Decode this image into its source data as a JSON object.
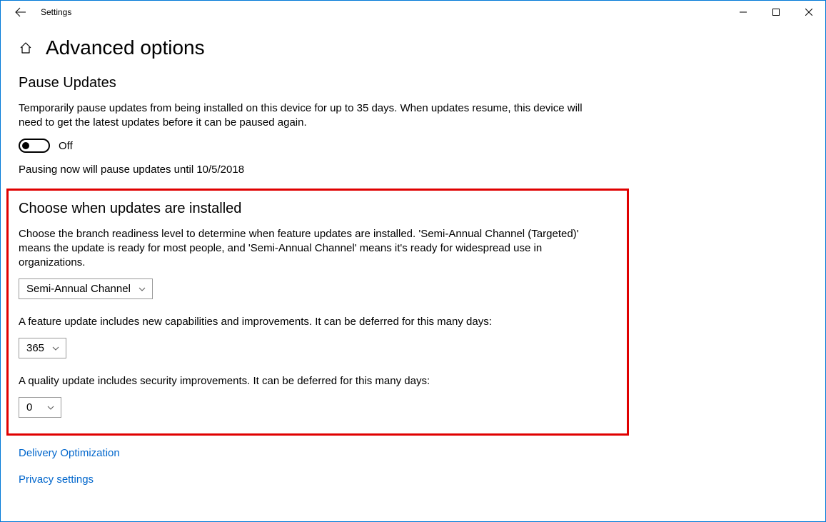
{
  "window": {
    "title": "Settings"
  },
  "page": {
    "title": "Advanced options"
  },
  "pause": {
    "heading": "Pause Updates",
    "desc": "Temporarily pause updates from being installed on this device for up to 35 days. When updates resume, this device will need to get the latest updates before it can be paused again.",
    "toggle_state": "Off",
    "note": "Pausing now will pause updates until 10/5/2018"
  },
  "choose": {
    "heading": "Choose when updates are installed",
    "desc": "Choose the branch readiness level to determine when feature updates are installed. 'Semi-Annual Channel (Targeted)' means the update is ready for most people, and 'Semi-Annual Channel' means it's ready for widespread use in organizations.",
    "channel_value": "Semi-Annual Channel",
    "feature_label": "A feature update includes new capabilities and improvements. It can be deferred for this many days:",
    "feature_value": "365",
    "quality_label": "A quality update includes security improvements. It can be deferred for this many days:",
    "quality_value": "0"
  },
  "links": {
    "delivery": "Delivery Optimization",
    "privacy": "Privacy settings"
  }
}
